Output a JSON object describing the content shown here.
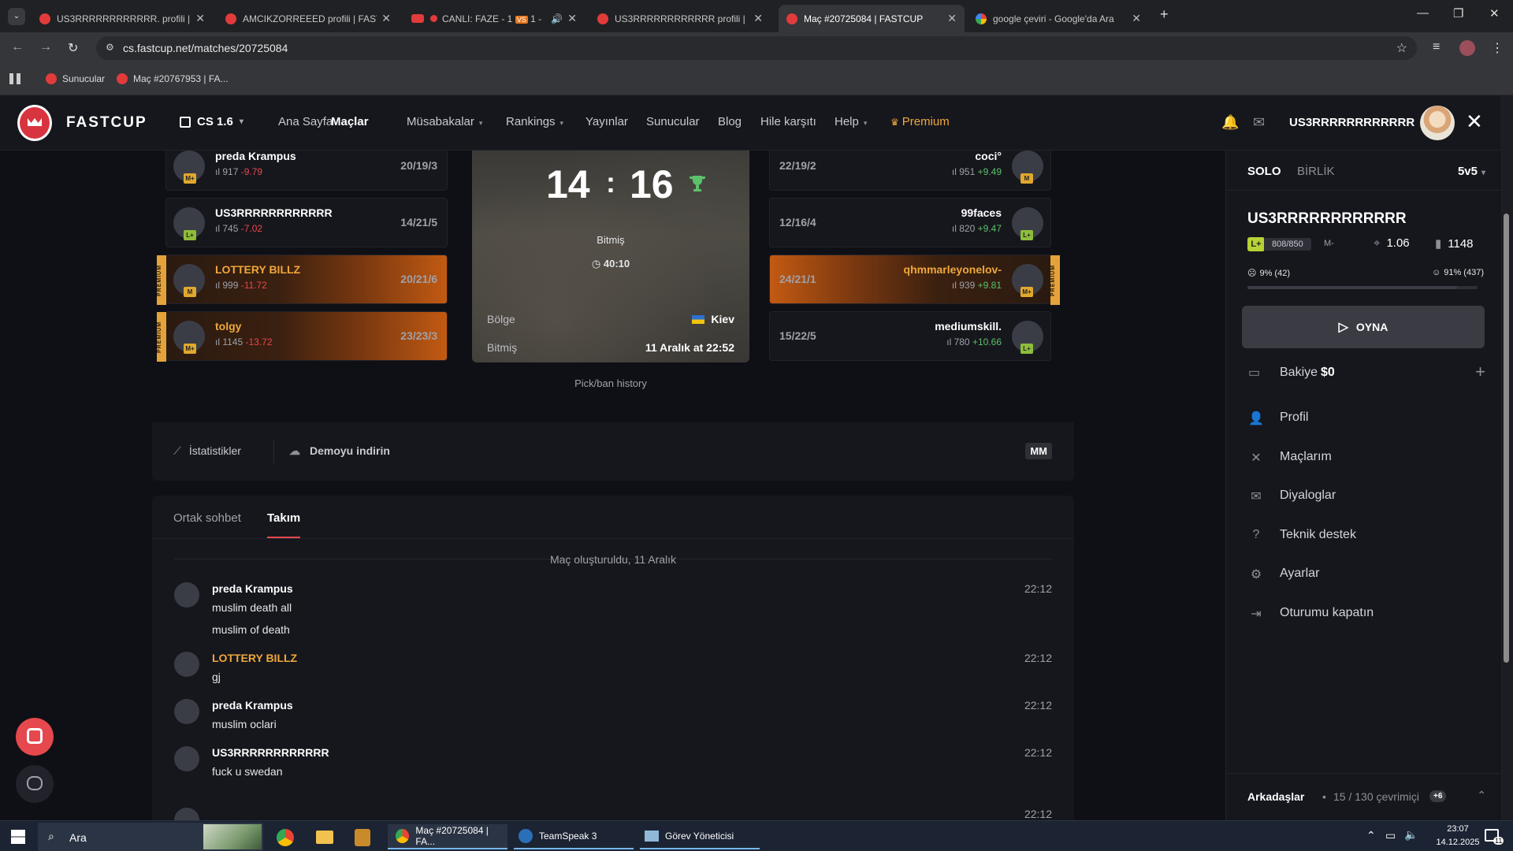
{
  "browser": {
    "tabs": [
      {
        "title": "US3RRRRRRRRRRRR. profili | FA"
      },
      {
        "title": "AMCIKZORREEED profili | FASTC"
      },
      {
        "title": "CANLI: FAZE - 1",
        "badge": "VS",
        "suffix": "1 -"
      },
      {
        "title": "US3RRRRRRRRRRRR profili | FA"
      },
      {
        "title": "Maç #20725084 | FASTCUP",
        "active": true
      },
      {
        "title": "google çeviri - Google'da Ara"
      }
    ],
    "url": "cs.fastcup.net/matches/20725084",
    "bookmarks": [
      "Sunucular",
      "Maç #20767953 | FA..."
    ]
  },
  "header": {
    "logo": "FASTCUP",
    "game": "CS 1.6",
    "nav": [
      {
        "label": "Ana Sayfa",
        "dropdown": false
      },
      {
        "label": "Maçlar",
        "dropdown": false,
        "active": true
      },
      {
        "label": "Müsabakalar",
        "dropdown": true
      },
      {
        "label": "Rankings",
        "dropdown": true
      },
      {
        "label": "Yayınlar",
        "dropdown": false
      },
      {
        "label": "Sunucular",
        "dropdown": false
      },
      {
        "label": "Blog",
        "dropdown": false
      },
      {
        "label": "Hile karşıtı",
        "dropdown": false
      },
      {
        "label": "Help",
        "dropdown": true
      },
      {
        "label": "Premium",
        "dropdown": false,
        "premium": true
      }
    ],
    "username": "US3RRRRRRRRRRRR"
  },
  "match": {
    "team_left": [
      {
        "name": "preda Krampus",
        "elo": "917",
        "delta": "-9.79",
        "score": "20/19/3",
        "level": "M+",
        "premium": false
      },
      {
        "name": "US3RRRRRRRRRRRR",
        "elo": "745",
        "delta": "-7.02",
        "score": "14/21/5",
        "level": "L+",
        "premium": false
      },
      {
        "name": "LOTTERY BILLZ",
        "elo": "999",
        "delta": "-11.72",
        "score": "20/21/6",
        "level": "M",
        "premium": true
      },
      {
        "name": "tolgy",
        "elo": "1145",
        "delta": "-13.72",
        "score": "23/23/3",
        "level": "M+",
        "premium": true
      }
    ],
    "team_right": [
      {
        "name": "coci°",
        "elo": "951",
        "delta": "+9.49",
        "score": "22/19/2",
        "level": "M",
        "premium": false
      },
      {
        "name": "99faces",
        "elo": "820",
        "delta": "+9.47",
        "score": "12/16/4",
        "level": "L+",
        "premium": false
      },
      {
        "name": "qhmmarleyonelov-",
        "elo": "939",
        "delta": "+9.81",
        "score": "24/21/1",
        "level": "M+",
        "premium": true
      },
      {
        "name": "mediumskill.",
        "elo": "780",
        "delta": "+10.66",
        "score": "15/22/5",
        "level": "L+",
        "premium": false
      }
    ],
    "score_left": "14",
    "score_right": "16",
    "status": "Bitmiş",
    "duration": "40:10",
    "region_label": "Bölge",
    "region_value": "Kiev",
    "finished_label": "Bitmiş",
    "finished_value": "11 Aralık at 22:52",
    "pickban": "Pick/ban history"
  },
  "actions": {
    "stats": "İstatistikler",
    "demo": "Demoyu indirin",
    "mode": "MM"
  },
  "chat": {
    "tabs": [
      "Ortak sohbet",
      "Takım"
    ],
    "active_tab": 1,
    "created": "Maç oluşturuldu, 11 Aralık",
    "messages": [
      {
        "author": "preda Krampus",
        "lines": [
          "muslim death all",
          "muslim of death"
        ],
        "time": "22:12",
        "gold": false
      },
      {
        "author": "LOTTERY BILLZ",
        "lines": [
          "gj"
        ],
        "time": "22:12",
        "gold": true
      },
      {
        "author": "preda Krampus",
        "lines": [
          "muslim oclari"
        ],
        "time": "22:12",
        "gold": false
      },
      {
        "author": "US3RRRRRRRRRRRR",
        "lines": [
          "fuck u swedan"
        ],
        "time": "22:12",
        "gold": false
      }
    ],
    "partial_time": "22:12"
  },
  "sidebar": {
    "tabs": [
      "SOLO",
      "BİRLİK"
    ],
    "mode": "5v5",
    "username": "US3RRRRRRRRRRRR",
    "level_badge": "L+",
    "xp": "808/850",
    "next_level": "M-",
    "kd": "1.06",
    "elo": "1148",
    "loss_pct": "9% (42)",
    "win_pct": "91% (437)",
    "win_ratio": 0.91,
    "play_button": "OYNA",
    "balance_label": "Bakiye",
    "balance_value": "$0",
    "menu": [
      "Profil",
      "Maçlarım",
      "Diyaloglar",
      "Teknik destek",
      "Ayarlar",
      "Oturumu kapatın"
    ],
    "friends_label": "Arkadaşlar",
    "friends_count": "15 / 130 çevrimiçi",
    "friends_badge": "+6"
  },
  "taskbar": {
    "search": "Ara",
    "apps": [
      "Maç #20725084 | FA...",
      "TeamSpeak 3",
      "Görev Yöneticisi"
    ],
    "time": "23:07",
    "date": "14.12.2025",
    "notif_count": "11"
  }
}
